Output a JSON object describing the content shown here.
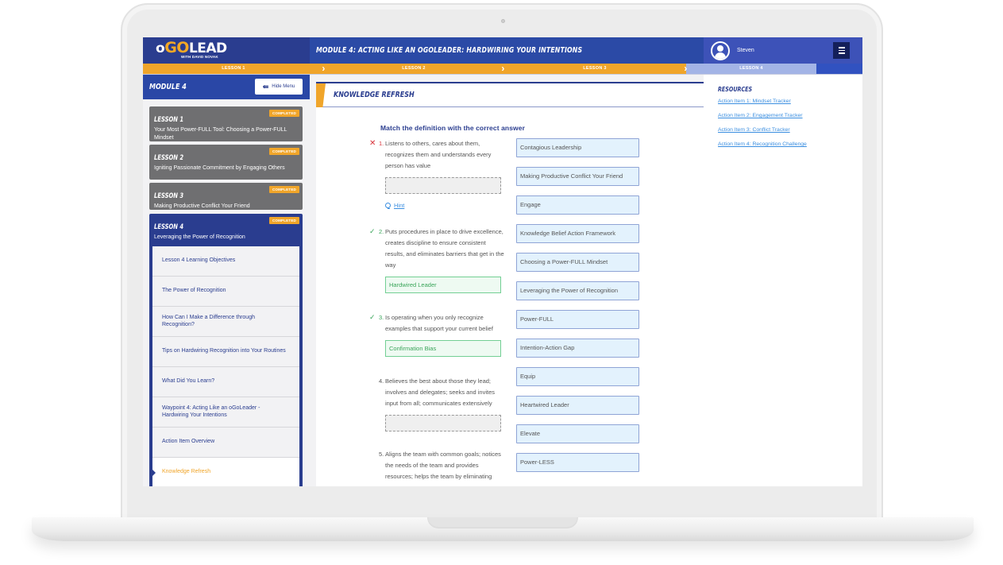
{
  "header": {
    "logo_prefix": "o",
    "logo_go": "GO",
    "logo_suffix": "LEAD",
    "logo_sub": "WITH DAVID NOVAK",
    "module_title": "Module 4: Acting Like an oGoLeader: Hardwiring Your Intentions",
    "user_name": "Steven",
    "menu_icon": "hamburger-icon"
  },
  "lesson_bar": [
    {
      "label": "LESSON 1",
      "state": "completed"
    },
    {
      "label": "LESSON 2",
      "state": "completed"
    },
    {
      "label": "LESSON 3",
      "state": "completed"
    },
    {
      "label": "LESSON 4",
      "state": "current"
    }
  ],
  "sidebar": {
    "module_label": "Module 4",
    "hide_menu_label": "Hide Menu",
    "lessons": [
      {
        "number": "Lesson 1",
        "title": "Your Most Power-FULL Tool: Choosing a Power-FULL Mindset",
        "badge": "COMPLETED"
      },
      {
        "number": "Lesson 2",
        "title": "Igniting Passionate Commitment by Engaging Others",
        "badge": "COMPLETED"
      },
      {
        "number": "Lesson 3",
        "title": "Making Productive Conflict Your Friend",
        "badge": "COMPLETED"
      },
      {
        "number": "Lesson 4",
        "title": "Leveraging the Power of Recognition",
        "badge": "COMPLETED"
      }
    ],
    "sub_items": [
      "Lesson 4 Learning Objectives",
      "The Power of Recognition",
      "How Can I Make a Difference through Recognition?",
      "Tips on Hardwiring Recognition into Your Routines",
      "What Did You Learn?",
      "Waypoint 4: Acting Like an oGoLeader - Hardwiring Your Intentions",
      "Action Item Overview",
      "Knowledge Refresh"
    ],
    "current_sub_item": "Knowledge Refresh"
  },
  "main": {
    "section_title": "Knowledge Refresh",
    "instructions": "Match the definition with the correct answer",
    "hint_label": "Hint",
    "questions": [
      {
        "num": "1.",
        "status": "wrong",
        "text": "Listens to others, cares about them, recognizes them and understands every person has value",
        "answer": ""
      },
      {
        "num": "2.",
        "status": "correct",
        "text": "Puts procedures in place to drive excellence, creates discipline to ensure consistent results, and eliminates barriers that get in the way",
        "answer": "Hardwired Leader"
      },
      {
        "num": "3.",
        "status": "correct",
        "text": "Is operating when you only recognize examples that support your current belief",
        "answer": "Confirmation Bias"
      },
      {
        "num": "4.",
        "status": "unanswered",
        "text": "Believes the best about those they lead; involves and delegates; seeks and invites input from all; communicates extensively",
        "answer": ""
      },
      {
        "num": "5.",
        "status": "unanswered",
        "text": "Aligns the team with common goals; notices the needs of the team and provides resources; helps the team by eliminating",
        "answer": ""
      }
    ],
    "answer_bank": [
      "Contagious Leadership",
      "Making Productive Conflict Your Friend",
      "Engage",
      "Knowledge Belief Action Framework",
      "Choosing a Power-FULL Mindset",
      "Leveraging the Power of Recognition",
      "Power-FULL",
      "Intention-Action Gap",
      "Equip",
      "Heartwired Leader",
      "Elevate",
      "Power-LESS"
    ]
  },
  "resources": {
    "title": "Resources",
    "links": [
      "Action Item 1: Mindset Tracker",
      "Action Item 2: Engagement Tracker",
      "Action Item 3: Conflict Tracker",
      "Action Item 4: Recognition Challenge"
    ]
  },
  "colors": {
    "brand_navy": "#2a3d8f",
    "brand_blue": "#2b4aa6",
    "accent_orange": "#f0a52a",
    "correct_green": "#3aa55a",
    "wrong_red": "#d8333b",
    "link_blue": "#3a8ee0"
  }
}
